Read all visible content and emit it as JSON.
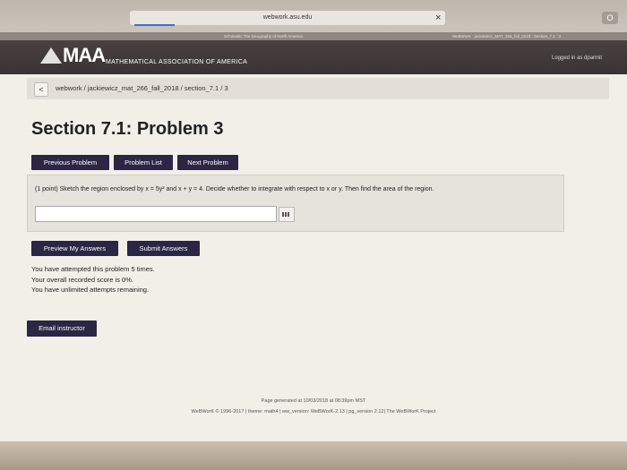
{
  "browser": {
    "url": "webwork.asu.edu",
    "close_glyph": "×",
    "tab_left": "Scholastic The Geography of North America",
    "tab_right": "WeBWorK : jackiewicz_MAT_266_fall_2018 : Section_7.1 : 3",
    "menu_glyph": "O"
  },
  "header": {
    "logo": "MAA",
    "subtitle": "MATHEMATICAL ASSOCIATION OF AMERICA",
    "logged_in": "Logged in as dparmit"
  },
  "breadcrumb": {
    "back_glyph": "<",
    "path": "webwork / jackiewicz_mat_266_fall_2018 / section_7.1 / 3"
  },
  "page": {
    "title": "Section 7.1: Problem 3"
  },
  "nav_buttons": {
    "previous": "Previous Problem",
    "list": "Problem List",
    "next": "Next Problem"
  },
  "problem": {
    "text": "(1 point) Sketch the region enclosed by x = 5y² and x + y = 4. Decide whether to integrate with respect to x or y. Then find the area of the region.",
    "answer_value": ""
  },
  "actions": {
    "preview": "Preview My Answers",
    "submit": "Submit Answers"
  },
  "status": {
    "line1": "You have attempted this problem 5 times.",
    "line2": "Your overall recorded score is 0%.",
    "line3": "You have unlimited attempts remaining."
  },
  "email_button": "Email instructor",
  "footer": {
    "line1": "Page generated at 10/03/2018 at 08:39pm MST",
    "line2": "WeBWorK © 1996-2017 | theme: math4 | ww_version: WeBWorK-2.13 | pg_version 2.12| The WeBWorK Project"
  },
  "colors": {
    "button_bg": "#2a2644",
    "header_bg": "#3a3333"
  }
}
